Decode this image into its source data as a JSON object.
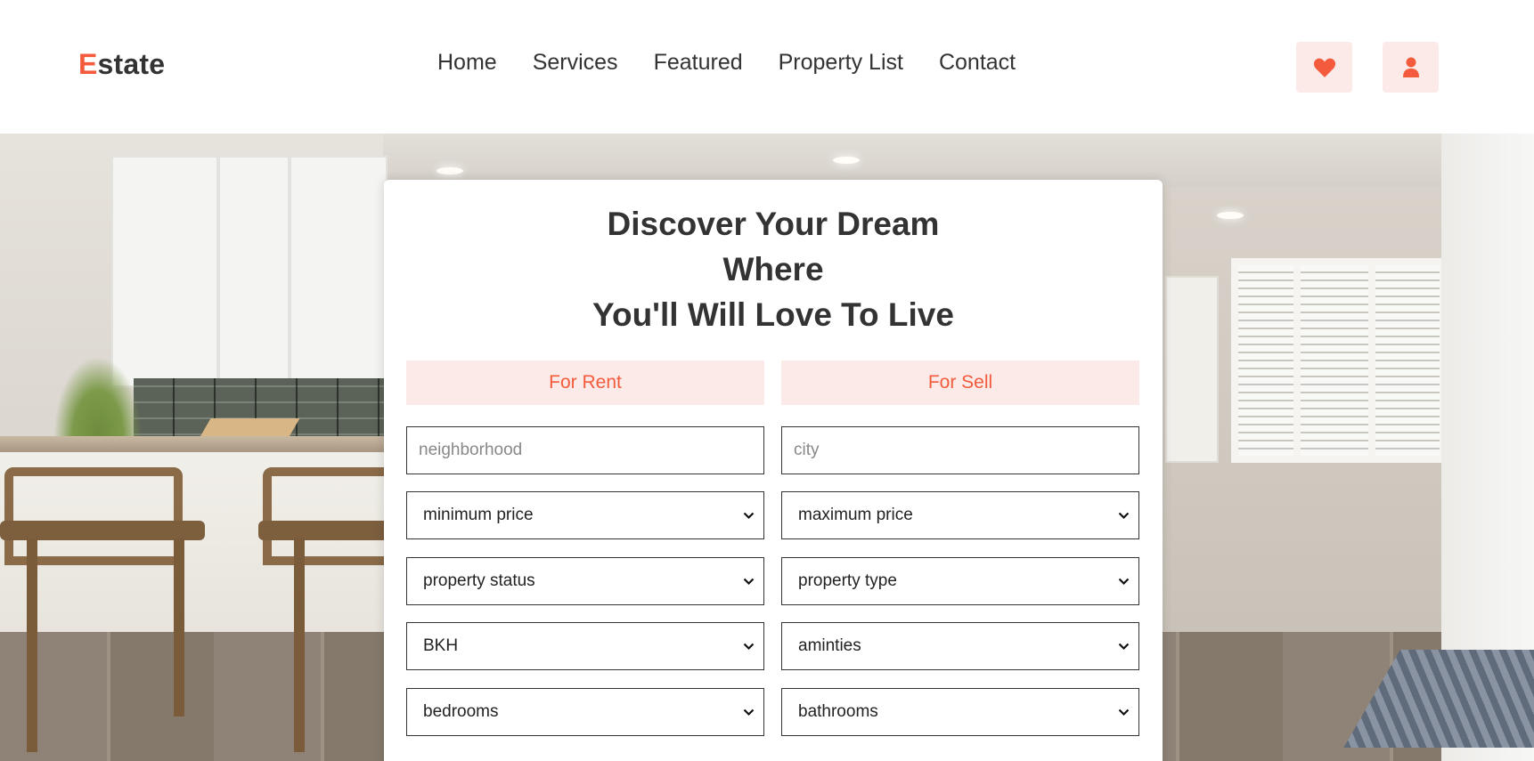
{
  "header": {
    "logo_first": "E",
    "logo_rest": "state",
    "nav": [
      "Home",
      "Services",
      "Featured",
      "Property List",
      "Contact"
    ],
    "icons": [
      "heart-icon",
      "user-icon"
    ],
    "accent_color": "#f35b3c",
    "icon_bg_color": "#fbeae8"
  },
  "search": {
    "title_lines": [
      "Discover Your Dream",
      "Where",
      "You'll Will Love To Live"
    ],
    "tabs": [
      "For Rent",
      "For Sell"
    ],
    "neighborhood_placeholder": "neighborhood",
    "city_placeholder": "city",
    "selects": {
      "min_price": "minimum price",
      "max_price": "maximum price",
      "property_status": "property status",
      "property_type": "property type",
      "bkh": "BKH",
      "amenities": "aminties",
      "bedrooms": "bedrooms",
      "bathrooms": "bathrooms"
    }
  }
}
